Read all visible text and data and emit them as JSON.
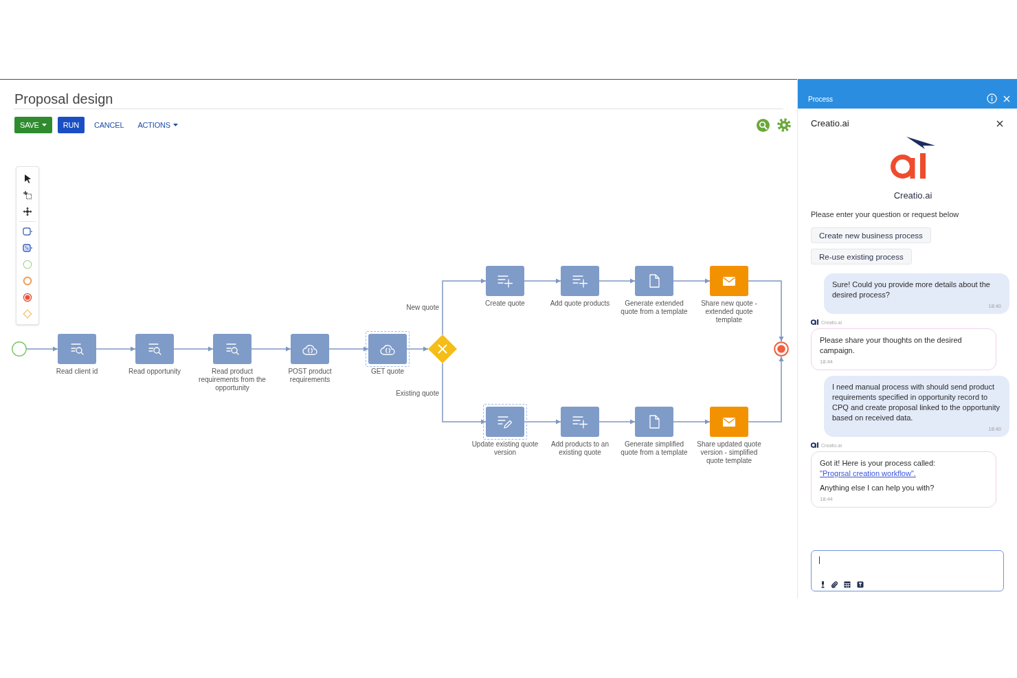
{
  "page": {
    "title": "Proposal design"
  },
  "toolbar": {
    "buttons": [
      {
        "label": "SAVE",
        "kind": "filled",
        "color": "#2e8b2e",
        "dropdown": true
      },
      {
        "label": "RUN",
        "kind": "filled",
        "color": "#1a4fc4",
        "dropdown": false
      },
      {
        "label": "CANCEL",
        "kind": "text",
        "dropdown": false
      },
      {
        "label": "ACTIONS",
        "kind": "text",
        "dropdown": true
      }
    ]
  },
  "diagram": {
    "main_flow": [
      {
        "label": "Read client id",
        "kind": "read",
        "selected": false
      },
      {
        "label": "Read opportunity",
        "kind": "read",
        "selected": false
      },
      {
        "label": "Read product requirements from the opportunity",
        "kind": "read",
        "selected": false
      },
      {
        "label": "POST product requirements",
        "kind": "web_service",
        "selected": false
      },
      {
        "label": "GET quote",
        "kind": "web_service",
        "selected": true
      }
    ],
    "branches": [
      {
        "label": "New quote",
        "nodes": [
          {
            "label": "Create quote",
            "kind": "add",
            "selected": false
          },
          {
            "label": "Add quote products",
            "kind": "add",
            "selected": false
          },
          {
            "label": "Generate extended quote from a template",
            "kind": "document",
            "selected": false
          },
          {
            "label": "Share new quote - extended quote template",
            "kind": "email",
            "selected": false
          }
        ]
      },
      {
        "label": "Existing quote",
        "nodes": [
          {
            "label": "Update existing quote version",
            "kind": "edit",
            "selected": true
          },
          {
            "label": "Add products to an existing quote",
            "kind": "add",
            "selected": false
          },
          {
            "label": "Generate simplified quote from a template",
            "kind": "document",
            "selected": false
          },
          {
            "label": "Share updated quote version - simplified quote template",
            "kind": "email",
            "selected": false
          }
        ]
      }
    ]
  },
  "panel": {
    "title": "Process",
    "assistant": {
      "title": "Creatio.ai",
      "caption": "Creatio.ai",
      "prompt": "Please enter your question or request below",
      "suggestions": [
        "Create new business process",
        "Re-use existing process"
      ],
      "messages": [
        {
          "kind": "outgoing",
          "paragraphs": [
            {
              "text": "Sure! Could you provide more details about the desired process?"
            }
          ],
          "time": "18:40"
        },
        {
          "kind": "incoming",
          "sender": "Creatio.ai",
          "paragraphs": [
            {
              "text": "Please share your thoughts on the desired campaign."
            }
          ],
          "time": "18:44"
        },
        {
          "kind": "outgoing",
          "paragraphs": [
            {
              "text": "I need manual process with should send product requirements specified in opportunity record to CPQ and create proposal linked to the opportunity based on received data."
            }
          ],
          "time": "18:40"
        },
        {
          "kind": "incoming",
          "sender": "Creatio.ai",
          "paragraphs": [
            {
              "text": "Got it! Here is your process called: ",
              "link": "\"Progrsal creation workflow\"."
            },
            {
              "text": "Anything else I can help you with?"
            }
          ],
          "time": "18:44"
        }
      ],
      "input": {
        "focused": true
      }
    }
  }
}
